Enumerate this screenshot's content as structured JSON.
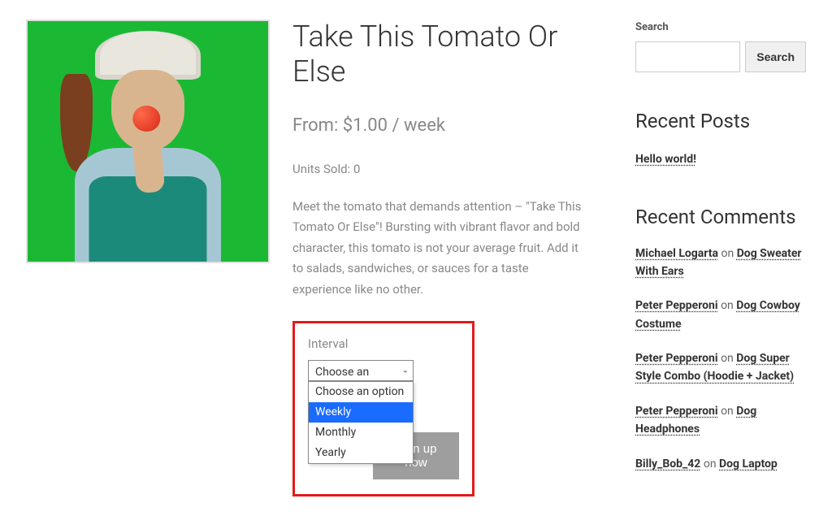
{
  "product": {
    "title": "Take This Tomato Or Else",
    "price_line": "From: $1.00 / week",
    "units_sold": "Units Sold: 0",
    "description": "Meet the tomato that demands attention – \"Take This Tomato Or Else\"! Bursting with vibrant flavor and bold character, this tomato is not your average fruit. Add it to salads, sandwiches, or sauces for a taste experience like no other.",
    "interval_label": "Interval",
    "interval_selected": "Choose an option",
    "interval_options": [
      {
        "label": "Choose an option",
        "highlighted": false
      },
      {
        "label": "Weekly",
        "highlighted": true
      },
      {
        "label": "Monthly",
        "highlighted": false
      },
      {
        "label": "Yearly",
        "highlighted": false
      }
    ],
    "signup_button": "Sign up now"
  },
  "sidebar": {
    "search_label": "Search",
    "search_button": "Search",
    "recent_posts_heading": "Recent Posts",
    "posts": [
      {
        "title": "Hello world!"
      }
    ],
    "recent_comments_heading": "Recent Comments",
    "comments": [
      {
        "author": "Michael Logarta",
        "on": "on",
        "target": "Dog Sweater With Ears"
      },
      {
        "author": "Peter Pepperoni",
        "on": "on",
        "target": "Dog Cowboy Costume"
      },
      {
        "author": "Peter Pepperoni",
        "on": "on",
        "target": "Dog Super Style Combo (Hoodie + Jacket)"
      },
      {
        "author": "Peter Pepperoni",
        "on": "on",
        "target": "Dog Headphones"
      },
      {
        "author": "Billy_Bob_42",
        "on": "on",
        "target": "Dog Laptop"
      }
    ]
  }
}
